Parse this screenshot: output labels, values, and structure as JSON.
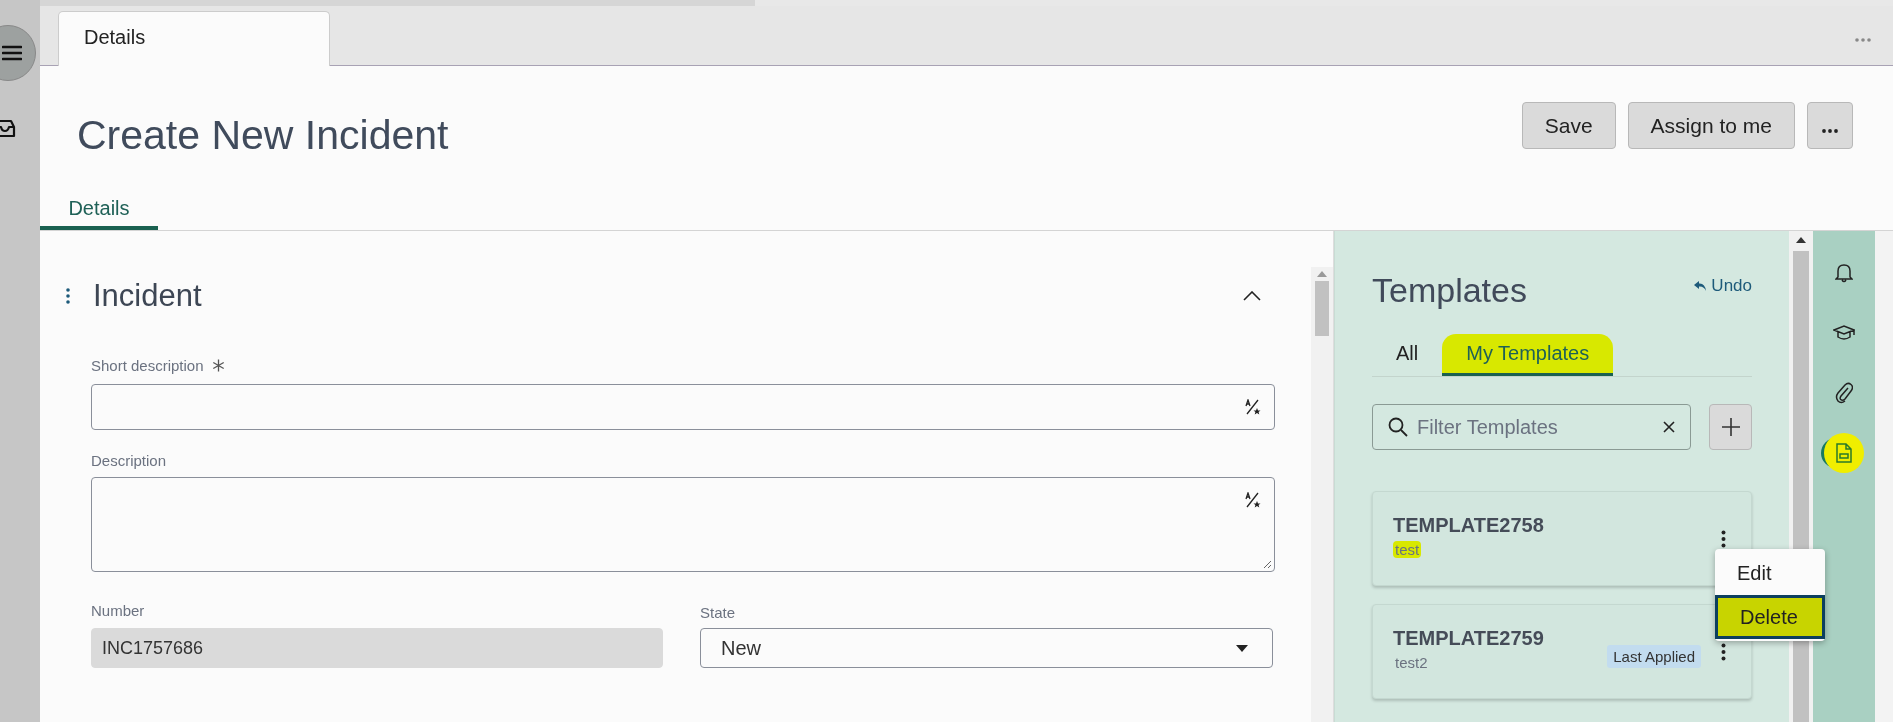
{
  "window_tabs": [
    {
      "label": "Details",
      "selected": true
    }
  ],
  "page": {
    "title": "Create New Incident",
    "buttons": [
      "Save",
      "Assign to me"
    ]
  },
  "subtabs": [
    {
      "label": "Details",
      "selected": true
    }
  ],
  "section": {
    "title": "Incident",
    "expanded": true
  },
  "fields": [
    {
      "kind": "text",
      "label": "Short description",
      "required": true
    },
    {
      "kind": "textarea",
      "label": "Description",
      "required": false
    },
    {
      "kind": "readonly",
      "label": "Number",
      "value": "INC1757686"
    },
    {
      "kind": "select",
      "label": "State",
      "value": "New"
    }
  ],
  "templates": {
    "title": "Templates",
    "undo": "Undo",
    "tabs": [
      {
        "label": "All",
        "selected": false,
        "highlighted": false
      },
      {
        "label": "My Templates",
        "selected": true,
        "highlighted": true
      }
    ],
    "search": {
      "placeholder": "Filter Templates"
    },
    "cards": [
      {
        "name": "TEMPLATE2758",
        "description": "test",
        "highlighted": true,
        "menu": [
          {
            "label": "Edit",
            "selected": false,
            "highlighted": false
          },
          {
            "label": "Delete",
            "selected": true,
            "highlighted": true
          }
        ]
      },
      {
        "name": "TEMPLATE2759",
        "description": "test2",
        "highlighted": false,
        "badge": "Last Applied"
      }
    ]
  },
  "right_rail": [
    {
      "selected": false,
      "highlighted": false
    },
    {
      "selected": false,
      "highlighted": false
    },
    {
      "selected": false,
      "highlighted": false
    },
    {
      "selected": true,
      "highlighted": true
    }
  ]
}
